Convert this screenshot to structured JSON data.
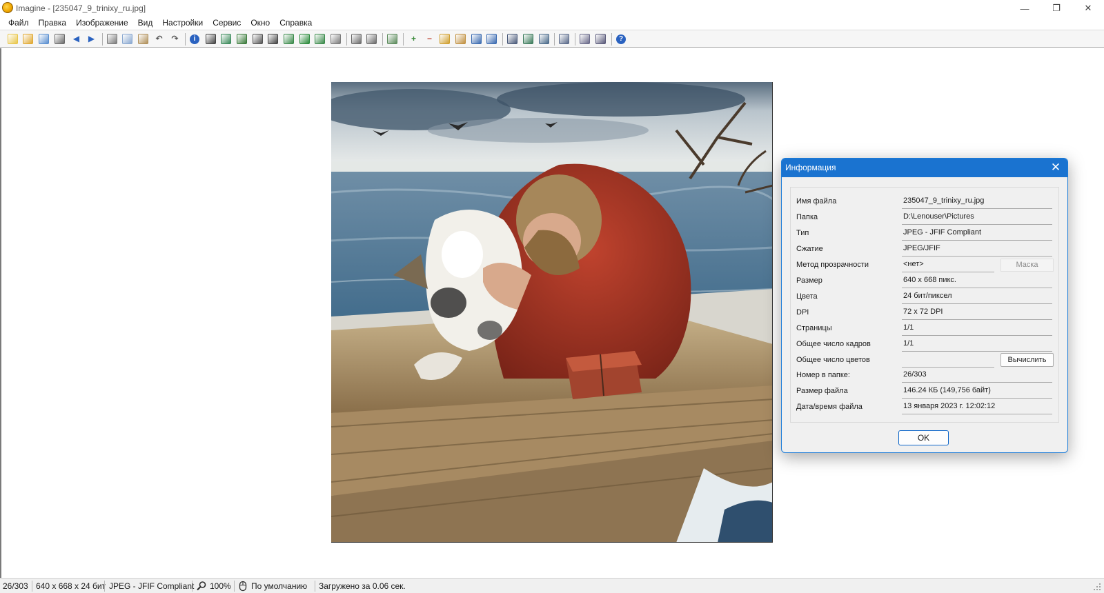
{
  "window": {
    "title": "Imagine - [235047_9_trinixy_ru.jpg]",
    "minimize_glyph": "—",
    "maximize_glyph": "❐",
    "close_glyph": "✕"
  },
  "menu": {
    "items": [
      "Файл",
      "Правка",
      "Изображение",
      "Вид",
      "Настройки",
      "Сервис",
      "Окно",
      "Справка"
    ]
  },
  "toolbar": {
    "buttons": [
      "new-icon",
      "open-icon",
      "save-all-icon",
      "print-icon",
      "prev-icon",
      "next-icon",
      "cut-icon",
      "copy-icon",
      "paste-icon",
      "undo-icon",
      "redo-icon",
      "info-icon",
      "capture-icon",
      "crop-icon",
      "resize-icon",
      "grayscale-icon",
      "negative-icon",
      "rotate-left-icon",
      "flip-icon",
      "rotate-right-icon",
      "effects-icon",
      "zoom-fit-icon",
      "zoom-actual-icon",
      "refresh-icon",
      "zoom-in-icon",
      "zoom-out-icon",
      "zoom-tool-icon",
      "view-window-icon",
      "view-full-icon",
      "view-split-icon",
      "slideshow-icon",
      "thumbnails-icon",
      "brush-icon",
      "tools-icon",
      "batch-icon",
      "convert-icon",
      "help-icon"
    ]
  },
  "dialog": {
    "title": "Информация",
    "close_glyph": "✕",
    "rows": [
      {
        "label": "Имя файла",
        "value": "235047_9_trinixy_ru.jpg"
      },
      {
        "label": "Папка",
        "value": "D:\\Lenouser\\Pictures"
      },
      {
        "label": "Тип",
        "value": "JPEG - JFIF Compliant"
      },
      {
        "label": "Сжатие",
        "value": "JPEG/JFIF"
      },
      {
        "label": "Метод прозрачности",
        "value": "<нет>"
      },
      {
        "label": "Размер",
        "value": "640 x 668 пикс."
      },
      {
        "label": "Цвета",
        "value": "24 бит/пиксел"
      },
      {
        "label": "DPI",
        "value": "72 x 72 DPI"
      },
      {
        "label": "Страницы",
        "value": "1/1"
      },
      {
        "label": "Общее число кадров",
        "value": "1/1"
      },
      {
        "label": "Общее число цветов",
        "value": ""
      },
      {
        "label": "Номер в папке:",
        "value": "26/303"
      },
      {
        "label": "Размер файла",
        "value": "146.24 КБ (149,756 байт)"
      },
      {
        "label": "Дата/время файла",
        "value": "13 января 2023 г. 12:02:12"
      }
    ],
    "mask_label": "Маска",
    "calc_label": "Вычислить",
    "ok_label": "OK"
  },
  "statusbar": {
    "index": "26/303",
    "dimensions": "640 x 668 x 24 бит",
    "format": "JPEG - JFIF Compliant",
    "zoom": "100%",
    "mode": "По умолчанию",
    "load_time": "Загружено за 0.06 сек."
  },
  "colors": {
    "dialog_title": "#1a73d0",
    "accent": "#1a7bd8"
  }
}
